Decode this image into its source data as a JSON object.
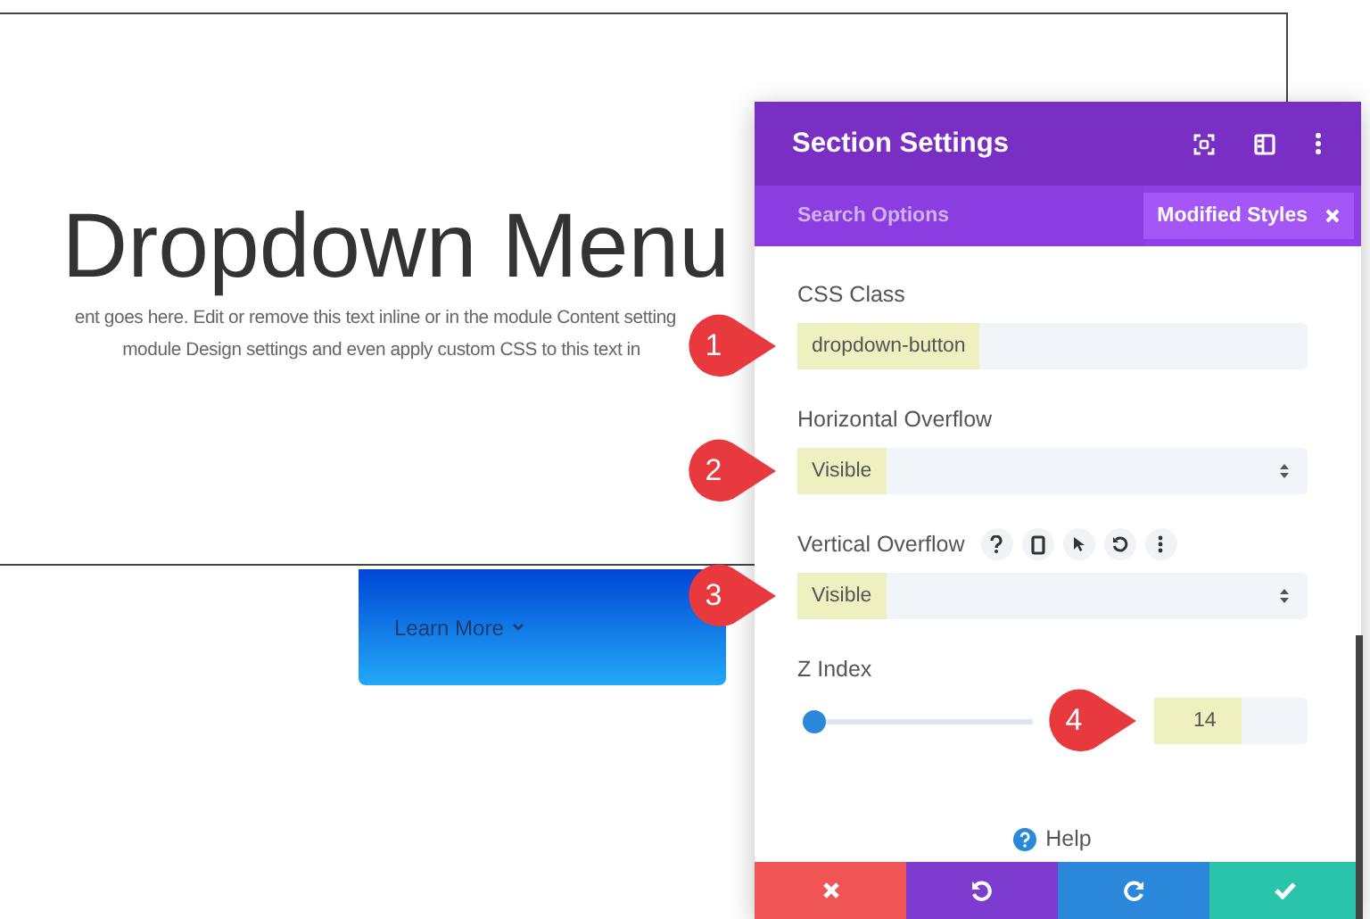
{
  "page": {
    "title": "Dropdown Menu",
    "body_lines": [
      "ent goes here. Edit or remove this text inline or in the module Content setting",
      "module Design settings and even apply custom CSS to this text in"
    ],
    "button": {
      "label": "Learn More"
    }
  },
  "panel": {
    "title": "Section Settings",
    "search": {
      "placeholder": "Search Options"
    },
    "filter": {
      "label": "Modified Styles"
    },
    "fields": [
      {
        "kind": "text",
        "label": "CSS Class",
        "value": "dropdown-button",
        "highlighted": true,
        "tools": false,
        "callout": "1"
      },
      {
        "kind": "select",
        "label": "Horizontal Overflow",
        "value": "Visible",
        "highlighted": true,
        "tools": false,
        "callout": "2"
      },
      {
        "kind": "select",
        "label": "Vertical Overflow",
        "value": "Visible",
        "highlighted": true,
        "tools": true,
        "callout": "3"
      },
      {
        "kind": "slider",
        "label": "Z Index",
        "value": "14",
        "level": 0,
        "highlighted": true,
        "tools": false,
        "callout": "4"
      }
    ],
    "help": "Help"
  }
}
